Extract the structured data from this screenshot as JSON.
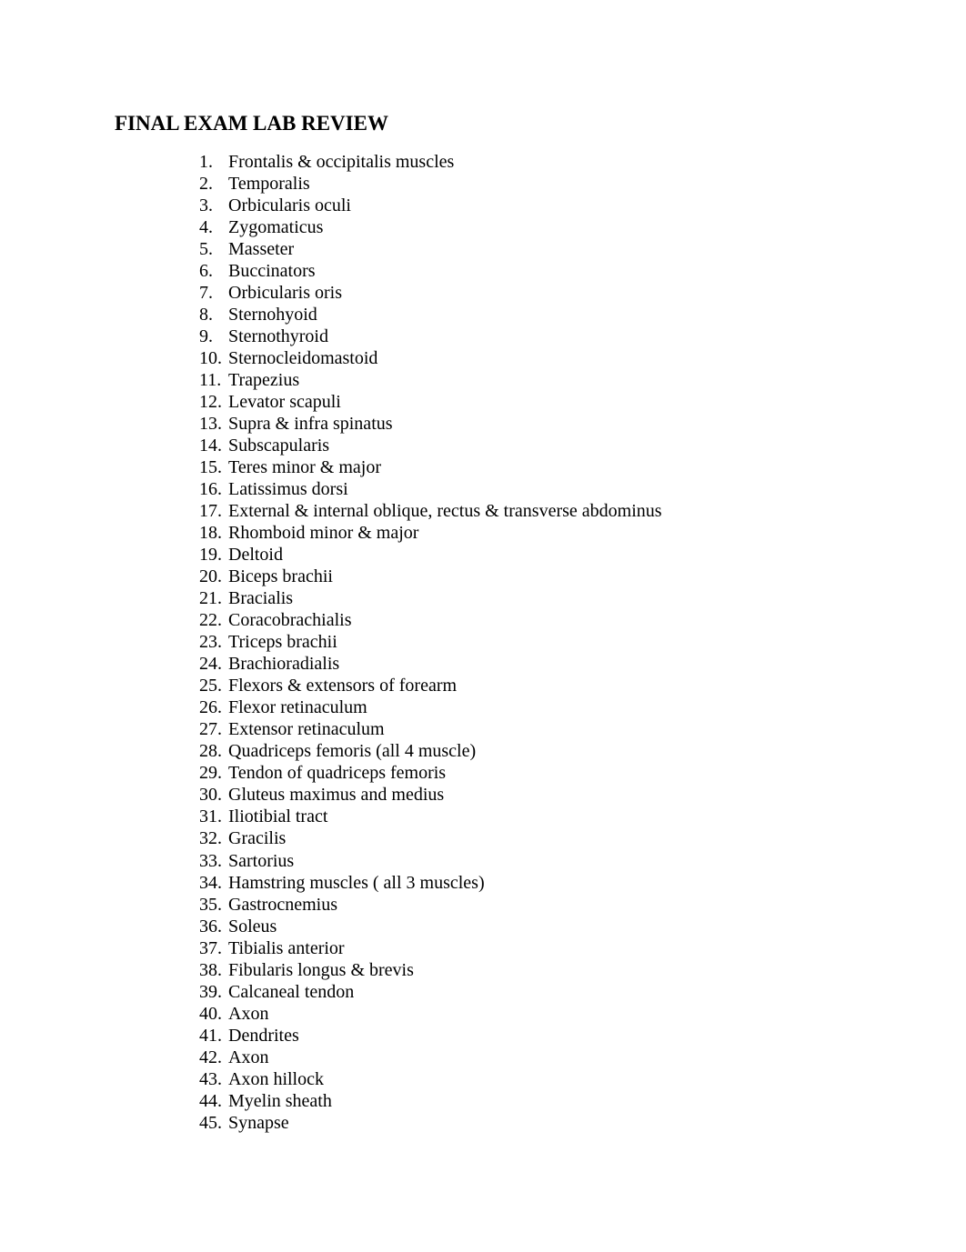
{
  "document": {
    "title": "FINAL EXAM LAB REVIEW",
    "items": [
      {
        "number": "1.",
        "text": "Frontalis & occipitalis muscles"
      },
      {
        "number": "2.",
        "text": "Temporalis"
      },
      {
        "number": "3.",
        "text": "Orbicularis oculi"
      },
      {
        "number": "4.",
        "text": "Zygomaticus"
      },
      {
        "number": "5.",
        "text": "Masseter"
      },
      {
        "number": "6.",
        "text": "Buccinators"
      },
      {
        "number": "7.",
        "text": "Orbicularis oris"
      },
      {
        "number": "8.",
        "text": "Sternohyoid"
      },
      {
        "number": "9.",
        "text": "Sternothyroid"
      },
      {
        "number": "10.",
        "text": "Sternocleidomastoid"
      },
      {
        "number": "11.",
        "text": "Trapezius"
      },
      {
        "number": "12.",
        "text": "Levator scapuli"
      },
      {
        "number": "13.",
        "text": "Supra & infra spinatus"
      },
      {
        "number": "14.",
        "text": "Subscapularis"
      },
      {
        "number": "15.",
        "text": "Teres minor & major"
      },
      {
        "number": "16.",
        "text": "Latissimus dorsi"
      },
      {
        "number": "17.",
        "text": "External & internal oblique, rectus & transverse abdominus"
      },
      {
        "number": "18.",
        "text": "Rhomboid minor & major"
      },
      {
        "number": "19.",
        "text": "Deltoid"
      },
      {
        "number": "20.",
        "text": "Biceps brachii"
      },
      {
        "number": "21.",
        "text": "Bracialis"
      },
      {
        "number": "22.",
        "text": "Coracobrachialis"
      },
      {
        "number": "23.",
        "text": "Triceps brachii"
      },
      {
        "number": "24.",
        "text": "Brachioradialis"
      },
      {
        "number": "25.",
        "text": "Flexors & extensors of forearm"
      },
      {
        "number": "26.",
        "text": "Flexor retinaculum"
      },
      {
        "number": "27.",
        "text": "Extensor retinaculum"
      },
      {
        "number": "28.",
        "text": "Quadriceps femoris (all 4 muscle)"
      },
      {
        "number": "29.",
        "text": "Tendon of quadriceps femoris"
      },
      {
        "number": "30.",
        "text": "Gluteus maximus and medius"
      },
      {
        "number": "31.",
        "text": "Iliotibial tract"
      },
      {
        "number": "32.",
        "text": "Gracilis"
      },
      {
        "number": "33.",
        "text": "Sartorius"
      },
      {
        "number": "34.",
        "text": "Hamstring muscles ( all 3 muscles)"
      },
      {
        "number": "35.",
        "text": "Gastrocnemius"
      },
      {
        "number": "36.",
        "text": "Soleus"
      },
      {
        "number": "37.",
        "text": "Tibialis anterior"
      },
      {
        "number": "38.",
        "text": "Fibularis longus & brevis"
      },
      {
        "number": "39.",
        "text": "Calcaneal tendon"
      },
      {
        "number": "40.",
        "text": "Axon"
      },
      {
        "number": "41.",
        "text": "Dendrites"
      },
      {
        "number": "42.",
        "text": "Axon"
      },
      {
        "number": "43.",
        "text": "Axon hillock"
      },
      {
        "number": "44.",
        "text": "Myelin sheath"
      },
      {
        "number": "45.",
        "text": "Synapse"
      }
    ]
  }
}
